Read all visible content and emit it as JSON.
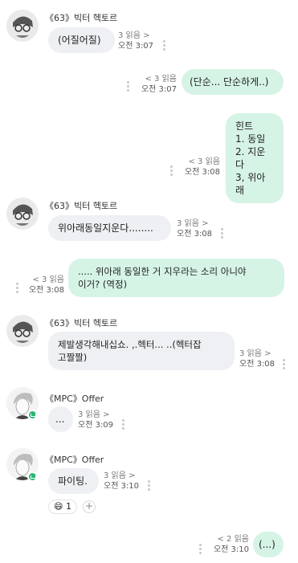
{
  "messages": [
    {
      "sender": "《63》빅터 헥토르",
      "text": "(어질어질)",
      "read": "3 읽음 >",
      "time": "오전 3:07"
    },
    {
      "text": "(단순... 단순하게..)",
      "read": "< 3 읽음",
      "time": "오전 3:07"
    },
    {
      "text": "힌트\n1. 동일\n2. 지운다\n3, 위아래",
      "read": "< 3 읽음",
      "time": "오전 3:08"
    },
    {
      "sender": "《63》빅터 헥토르",
      "text": "위아래동일지운다........",
      "read": "3 읽음 >",
      "time": "오전 3:08"
    },
    {
      "text": "..... 위아래 동일한 거 지우라는 소리 아니야\n이거? (역정)",
      "read": "< 3 읽음",
      "time": "오전 3:08"
    },
    {
      "sender": "《63》빅터 헥토르",
      "text": "제발생각해내십쇼. ,.헥터... ..(헥터잡\n고짤짤)",
      "read": "3 읽음 >",
      "time": "오전 3:08"
    },
    {
      "sender": "《MPC》Offer",
      "text": "...",
      "read": "3 읽음 >",
      "time": "오전 3:09"
    },
    {
      "sender": "《MPC》Offer",
      "text": "파이팅.",
      "read": "3 읽음 >",
      "time": "오전 3:10",
      "reaction": {
        "emoji": "😄",
        "count": "1",
        "add": "+"
      }
    },
    {
      "text": "(...)",
      "read": "< 2 읽음",
      "time": "오전 3:10"
    }
  ],
  "colors": {
    "incoming_bubble": "#eef0f3",
    "outgoing_bubble": "#d6f4e6",
    "online_badge": "#2bb673"
  },
  "icons": {
    "more": "vertical-ellipsis-icon",
    "online": "online-badge-icon",
    "reaction_add": "plus-icon"
  }
}
